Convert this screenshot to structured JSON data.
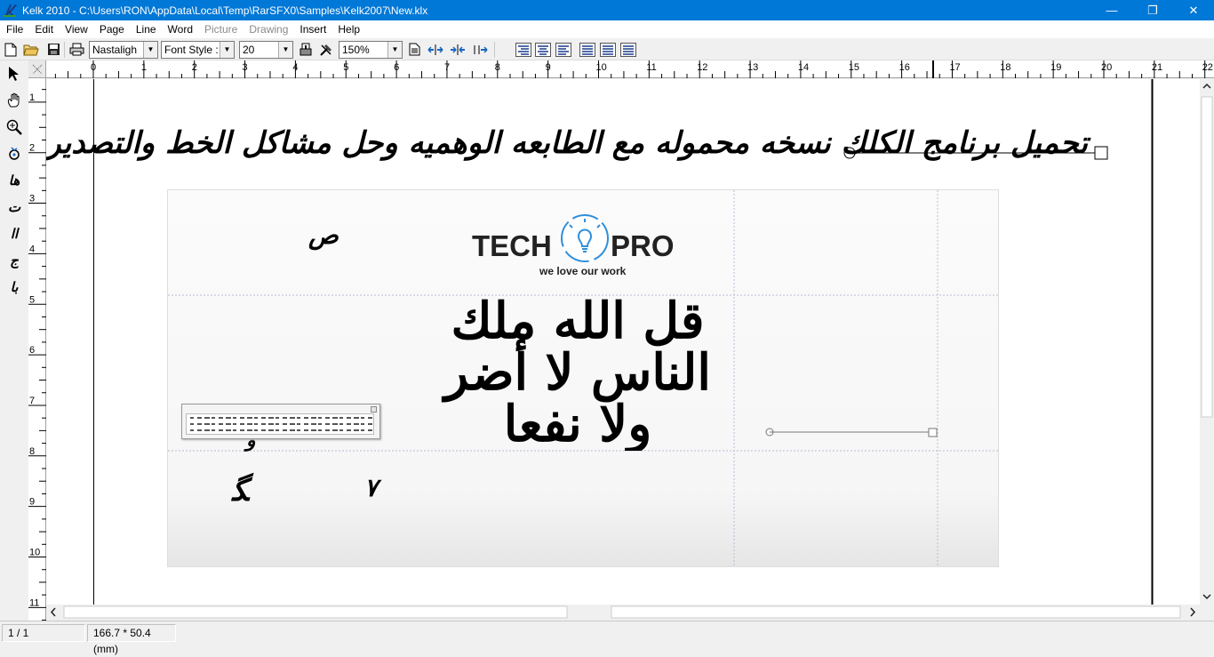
{
  "window": {
    "title": "Kelk 2010 - C:\\Users\\RON\\AppData\\Local\\Temp\\RarSFX0\\Samples\\Kelk2007\\New.klx",
    "minimize_glyph": "—",
    "maximize_glyph": "❐",
    "close_glyph": "✕"
  },
  "menu": {
    "items": [
      {
        "label": "File",
        "enabled": true
      },
      {
        "label": "Edit",
        "enabled": true
      },
      {
        "label": "View",
        "enabled": true
      },
      {
        "label": "Page",
        "enabled": true
      },
      {
        "label": "Line",
        "enabled": true
      },
      {
        "label": "Word",
        "enabled": true
      },
      {
        "label": "Picture",
        "enabled": false
      },
      {
        "label": "Drawing",
        "enabled": false
      },
      {
        "label": "Insert",
        "enabled": true
      },
      {
        "label": "Help",
        "enabled": true
      }
    ]
  },
  "toolbar": {
    "font_value": "Nastaligh",
    "style_value": "Font Style :",
    "size_value": "20",
    "zoom_value": "150%"
  },
  "ruler": {
    "h_ticks": [
      "0",
      "1",
      "2",
      "3",
      "4",
      "5",
      "6",
      "7",
      "8",
      "9",
      "10",
      "11",
      "12",
      "13",
      "14",
      "15",
      "16",
      "17",
      "18",
      "19",
      "20",
      "21",
      "22"
    ],
    "v_ticks": [
      "1",
      "2",
      "3",
      "4",
      "5",
      "6",
      "7",
      "8",
      "9",
      "10",
      "11"
    ]
  },
  "canvas": {
    "heading_text": "تحميل برنامج الكلك نسخه محموله مع الطابعه الوهميه وحل مشاكل الخط والتصدير والنقل للفوتشوب",
    "logo_tech": "TECH",
    "logo_pro": "PRO",
    "logo_tagline": "we love our work",
    "calligraphy_text": "قل الله ملك الناس لا أضر ولا نفعا",
    "small_glyph_1": "ص",
    "small_glyph_2": "٧",
    "small_glyph_3": "ﮕ",
    "small_glyph_4": "ﯞ"
  },
  "left_tools": {
    "t5": "ها",
    "t6": "ت",
    "t7": "اا",
    "t8": "ج",
    "t9": "با"
  },
  "status": {
    "page": "1 / 1",
    "dimensions": "166.7 * 50.4 (mm)"
  },
  "colors": {
    "titlebar": "#0078d7",
    "logo_blue": "#2e8fdc"
  }
}
